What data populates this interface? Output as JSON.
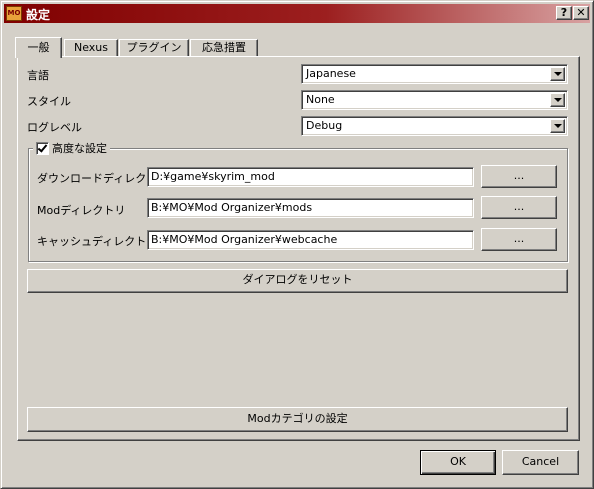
{
  "window": {
    "icon_text": "MO",
    "title": "設定",
    "help_label": "?",
    "close_label": "✕"
  },
  "tabs": [
    {
      "label": "一般",
      "active": true
    },
    {
      "label": "Nexus",
      "active": false
    },
    {
      "label": "プラグイン",
      "active": false
    },
    {
      "label": "応急措置",
      "active": false
    }
  ],
  "general": {
    "language_label": "言語",
    "language_value": "Japanese",
    "style_label": "スタイル",
    "style_value": "None",
    "loglevel_label": "ログレベル",
    "loglevel_value": "Debug",
    "advanced": {
      "label": "高度な設定",
      "checked": true,
      "download_dir_label": "ダウンロードディレクトリ",
      "download_dir_value": "D:¥game¥skyrim_mod",
      "mod_dir_label": "Modディレクトリ",
      "mod_dir_value": "B:¥MO¥Mod Organizer¥mods",
      "cache_dir_label": "キャッシュディレクトリ",
      "cache_dir_value": "B:¥MO¥Mod Organizer¥webcache",
      "browse_label": "..."
    },
    "reset_dialogs_label": "ダイアログをリセット",
    "mod_categories_label": "Modカテゴリの設定"
  },
  "footer": {
    "ok_label": "OK",
    "cancel_label": "Cancel"
  }
}
